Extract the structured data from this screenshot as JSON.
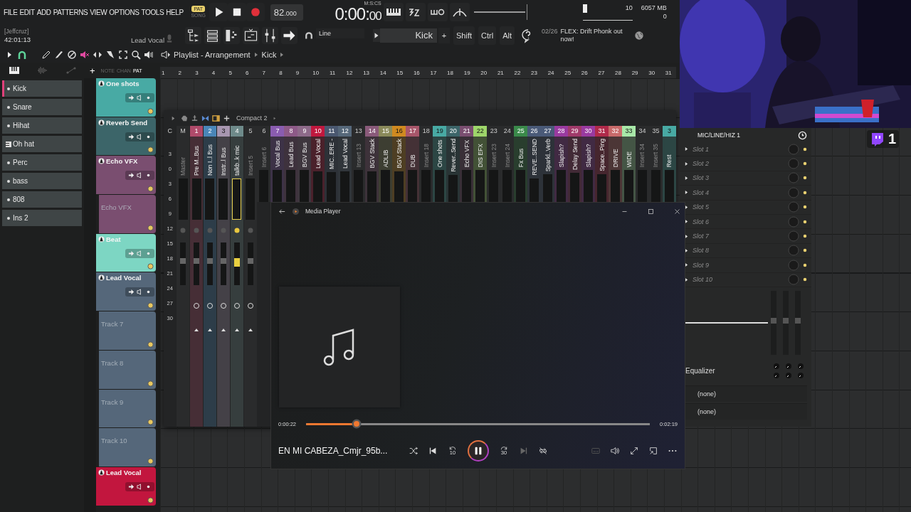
{
  "menu": [
    "FILE",
    "EDIT",
    "ADD",
    "PATTERNS",
    "VIEW",
    "OPTIONS",
    "TOOLS",
    "HELP"
  ],
  "transport": {
    "modes": [
      {
        "label": "PAT",
        "selected": true
      },
      {
        "label": "SONG",
        "selected": false
      }
    ],
    "tempo": "82",
    "tempo_fraction": ".000",
    "time": "0:00:",
    "time_cs": "00",
    "time_unit": "M:S:CS",
    "cpu": "10",
    "memory": "6057 MB",
    "polyphony": "0"
  },
  "session": {
    "user": "[Jeffcruz]",
    "time": "42:01:13",
    "hint": "Lead Vocal"
  },
  "toolbar": {
    "snap": "Line",
    "pattern": "Kick",
    "pattern_add": "+",
    "modifiers": [
      "Shift",
      "Ctrl",
      "Alt"
    ],
    "news_date": "02/26",
    "news_text": "FLEX: Drift Phonk out now!"
  },
  "playlist": {
    "title": "Playlist - Arrangement",
    "pattern": "Kick",
    "bars": [
      "1",
      "2",
      "3",
      "4",
      "5",
      "6",
      "7",
      "8",
      "9",
      "10",
      "11",
      "12",
      "13",
      "14",
      "15",
      "16",
      "17",
      "18",
      "19",
      "20",
      "21",
      "22",
      "23",
      "24",
      "25",
      "26",
      "27",
      "28",
      "29",
      "30",
      "31"
    ],
    "tracks": [
      {
        "name": "One shots",
        "color": "#48aaa4",
        "kind": "track"
      },
      {
        "name": "Reverb Send",
        "color": "#3c6569",
        "kind": "track"
      },
      {
        "name": "Echo VFX",
        "color": "#7a4e70",
        "kind": "track"
      },
      {
        "name": "Echo VFX",
        "color": "#7a4e70",
        "kind": "lane"
      },
      {
        "name": "Beat",
        "color": "#7dd6c3",
        "kind": "track"
      },
      {
        "name": "Lead Vocal",
        "color": "#55677a",
        "kind": "track"
      },
      {
        "name": "Track 7",
        "color": "#55677a",
        "kind": "lane"
      },
      {
        "name": "Track 8",
        "color": "#55677a",
        "kind": "lane"
      },
      {
        "name": "Track 9",
        "color": "#55677a",
        "kind": "lane"
      },
      {
        "name": "Track 10",
        "color": "#55677a",
        "kind": "lane"
      },
      {
        "name": "Lead Vocal",
        "color": "#c2163e",
        "kind": "track"
      }
    ]
  },
  "channel_rack": {
    "add": "+",
    "views": [
      {
        "label": "NOTE",
        "selected": false
      },
      {
        "label": "CHAN",
        "selected": false
      },
      {
        "label": "PAT",
        "selected": true
      }
    ],
    "channels": [
      {
        "name": "Kick",
        "selected": true,
        "kind": "sample"
      },
      {
        "name": "Snare",
        "selected": false,
        "kind": "sample"
      },
      {
        "name": "Hihat",
        "selected": false,
        "kind": "sample"
      },
      {
        "name": "Oh hat",
        "selected": false,
        "kind": "instrument"
      },
      {
        "name": "Perc",
        "selected": false,
        "kind": "sample"
      },
      {
        "name": "bass",
        "selected": false,
        "kind": "sample"
      },
      {
        "name": "808",
        "selected": false,
        "kind": "sample"
      },
      {
        "name": "Ins 2",
        "selected": false,
        "kind": "sample"
      }
    ]
  },
  "mixer": {
    "preset": "Compact 2",
    "column_header": "C",
    "scale": [
      "3",
      "0",
      "3",
      "6",
      "9",
      "12",
      "15",
      "18",
      "21",
      "24",
      "27",
      "30"
    ],
    "master": {
      "number": "M",
      "name": "Master"
    },
    "inserts": [
      {
        "number": "1",
        "name": "Pre M..Bus",
        "color": "#b04a6a",
        "selected": false
      },
      {
        "number": "2",
        "name": "Non I..l Bus",
        "color": "#4a86b8",
        "selected": false
      },
      {
        "number": "3",
        "name": "Instr..l Bus",
        "color": "#a796b0",
        "selected": false
      },
      {
        "number": "4",
        "name": "talkb..k mic",
        "color": "#6e8a8a",
        "selected": true
      },
      {
        "number": "5",
        "name": "Insert 5",
        "selected": false
      },
      {
        "number": "6",
        "name": "Insert 6",
        "selected": false
      },
      {
        "number": "7",
        "name": "Vocal Bus",
        "color": "#8a5cb0",
        "selected": false
      },
      {
        "number": "8",
        "name": "Lead Bus",
        "color": "#8e5a88",
        "selected": false
      },
      {
        "number": "9",
        "name": "BGV Bus",
        "color": "#8e6a8a",
        "selected": false
      },
      {
        "number": "10",
        "name": "Lead Vocal",
        "color": "#c0183e",
        "selected": false
      },
      {
        "number": "11",
        "name": "MIC..ERE -",
        "color": "#4a5870",
        "selected": false
      },
      {
        "number": "12",
        "name": "Lead Vocal",
        "color": "#56687a",
        "selected": false
      },
      {
        "number": "13",
        "name": "Insert 13",
        "selected": false
      },
      {
        "number": "14",
        "name": "BGV Stack",
        "color": "#8a5a7a",
        "selected": false
      },
      {
        "number": "15",
        "name": "ADLIB",
        "color": "#8a8a5a",
        "selected": false
      },
      {
        "number": "16",
        "name": "BGV Stack",
        "color": "#d08a20",
        "selected": false
      },
      {
        "number": "17",
        "name": "DUB",
        "color": "#a8566a",
        "selected": false
      },
      {
        "number": "18",
        "name": "Insert 18",
        "selected": false
      },
      {
        "number": "19",
        "name": "One shots",
        "color": "#48aaa4",
        "selected": false
      },
      {
        "number": "20",
        "name": "Rever..Send",
        "color": "#3c6569",
        "selected": false
      },
      {
        "number": "21",
        "name": "Echo VFX",
        "color": "#7a4e70",
        "selected": false
      },
      {
        "number": "22",
        "name": "DIS EFX",
        "color": "#9ed66a",
        "selected": false
      },
      {
        "number": "23",
        "name": "Insert 23",
        "selected": false
      },
      {
        "number": "24",
        "name": "Insert 24",
        "selected": false
      },
      {
        "number": "25",
        "name": "Fx Bus",
        "color": "#3a8a4a",
        "selected": false
      },
      {
        "number": "26",
        "name": "REVE..SEND",
        "color": "#4a5a78",
        "selected": false
      },
      {
        "number": "27",
        "name": "Sparkl..Verb",
        "color": "#4a5a78",
        "selected": false
      },
      {
        "number": "28",
        "name": "Slapish?",
        "color": "#9a3aa0",
        "selected": false
      },
      {
        "number": "29",
        "name": "Delay Send",
        "color": "#a03a6a",
        "selected": false
      },
      {
        "number": "30",
        "name": "Slapish?",
        "color": "#9a3aa0",
        "selected": false
      },
      {
        "number": "31",
        "name": "Space..Ping",
        "color": "#b02a4a",
        "selected": false
      },
      {
        "number": "32",
        "name": "DRIVE",
        "color": "#c86a6a",
        "selected": false
      },
      {
        "number": "33",
        "name": "WIDE",
        "color": "#a8e8a8",
        "selected": false
      },
      {
        "number": "34",
        "name": "Insert 34",
        "selected": false
      },
      {
        "number": "35",
        "name": "Insert 35",
        "selected": false
      },
      {
        "number": "3",
        "name": "Rest",
        "color": "#48aaa4",
        "selected": false
      }
    ]
  },
  "media_player": {
    "title": "Media Player",
    "elapsed": "0:00:22",
    "duration": "0:02:19",
    "level": 0.146,
    "track": "EN MI CABEZA_Cmjr_95b...",
    "playing": true,
    "skip_back": "10",
    "skip_forward": "30",
    "next_disabled": true,
    "captions_disabled": true
  },
  "channel_panel": {
    "input": "MIC/LINE/HIZ 1",
    "slots": [
      "Slot 1",
      "Slot 2",
      "Slot 3",
      "Slot 4",
      "Slot 5",
      "Slot 6",
      "Slot 7",
      "Slot 8",
      "Slot 9",
      "Slot 10"
    ],
    "eq_label": "Equalizer",
    "routes": [
      "(none)",
      "(none)"
    ]
  },
  "stream_overlay": {
    "viewers": "1"
  }
}
